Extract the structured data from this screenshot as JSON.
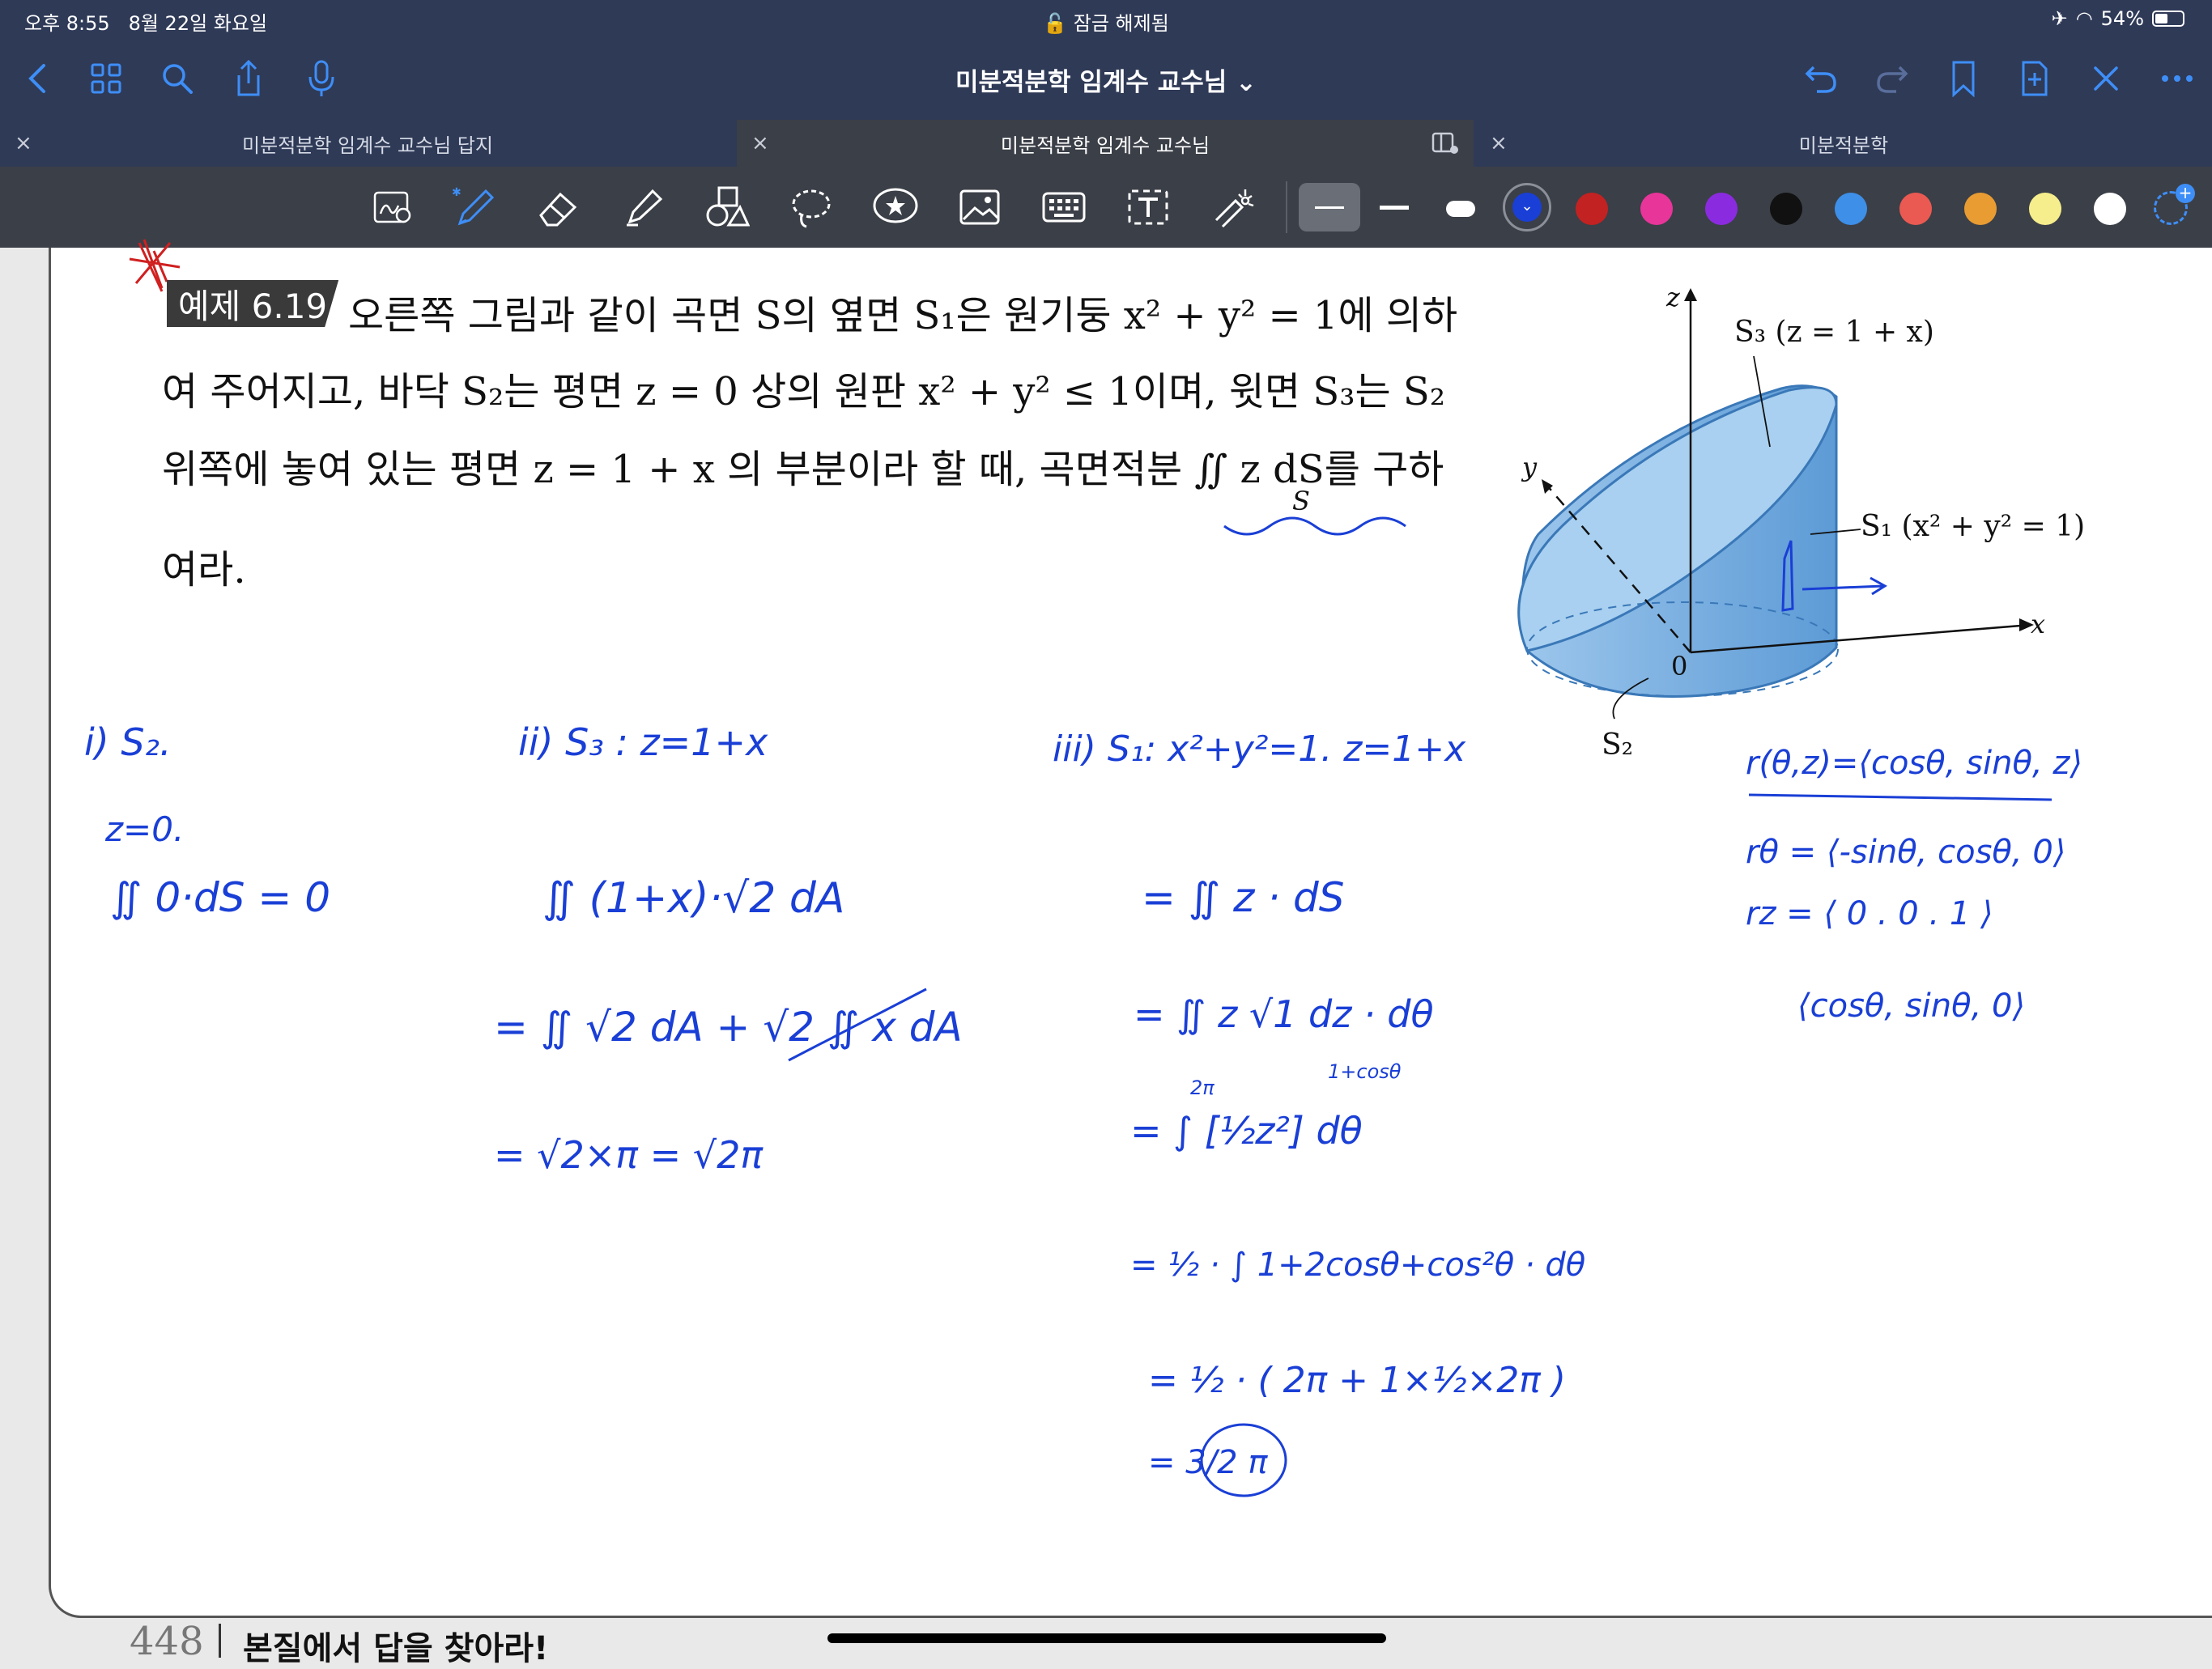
{
  "status": {
    "time": "오후 8:55",
    "date": "8월 22일 화요일",
    "lock": "잠금 해제됨",
    "battery": "54%",
    "battery_level": 0.54
  },
  "toolbar": {
    "title": "미분적분학 임계수 교수님 ⌄"
  },
  "tabs": [
    {
      "label": "미분적분학 임계수 교수님 답지"
    },
    {
      "label": "미분적분학 임계수 교수님"
    },
    {
      "label": "미분적분학"
    }
  ],
  "tab_close": "×",
  "colors": {
    "selected": "#1a3fd6",
    "red": "#c22222",
    "pink": "#e8359a",
    "purple": "#8b2be0",
    "black": "#111111",
    "blue": "#3d8fe8",
    "coral": "#ea5a52",
    "orange": "#e89c32",
    "yellow": "#f6ee8c",
    "white": "#ffffff"
  },
  "problem": {
    "badge": "예제 6.19",
    "line1": "오른쪽 그림과 같이 곡면 S의 옆면 S₁은 원기둥 x² + y² = 1에 의하",
    "line2": "여 주어지고, 바닥 S₂는 평면 z = 0 상의 원판 x² + y² ≤ 1이며, 윗면 S₃는 S₂",
    "line3": "위쪽에 놓여 있는 평면 z = 1 + x 의 부분이라 할 때, 곡면적분 ∬ z dS를 구하",
    "integral_sub": "S",
    "line4": "여라."
  },
  "figure": {
    "z": "z",
    "y": "y",
    "x": "x",
    "origin": "0",
    "s3": "S₃ (z = 1 + x)",
    "s1": "S₁ (x² + y² = 1)",
    "s2": "S₂"
  },
  "notes": {
    "n1": "i) S₂.",
    "n2": "z=0.",
    "n3": "∬ 0·dS = 0",
    "n4": "ii) S₃ : z=1+x",
    "n5": "∬ (1+x)·√2 dA",
    "n6": "= ∬ √2 dA + √2 ∬ x dA",
    "n7": "= √2×π = √2π",
    "n8": "iii) S₁: x²+y²=1.  z=1+x",
    "n9": "= ∬ z · dS",
    "n10": "= ∬ z √1 dz · dθ",
    "n11": "1+cosθ",
    "n12": "= ∫ [½z²] dθ",
    "n13": "2π",
    "n14": "= ½ · ∫ 1+2cosθ+cos²θ · dθ",
    "n15": "= ½ · ( 2π + 1×½×2π )",
    "n16": "= 3/2 π",
    "n17": "r(θ,z)=⟨cosθ, sinθ, z⟩",
    "n18": "rθ = ⟨-sinθ, cosθ, 0⟩",
    "n19": "rz = ⟨ 0 . 0 . 1 ⟩",
    "n20": "⟨cosθ, sinθ, 0⟩"
  },
  "footer": {
    "page": "448",
    "text": "본질에서 답을 찾아라!"
  }
}
